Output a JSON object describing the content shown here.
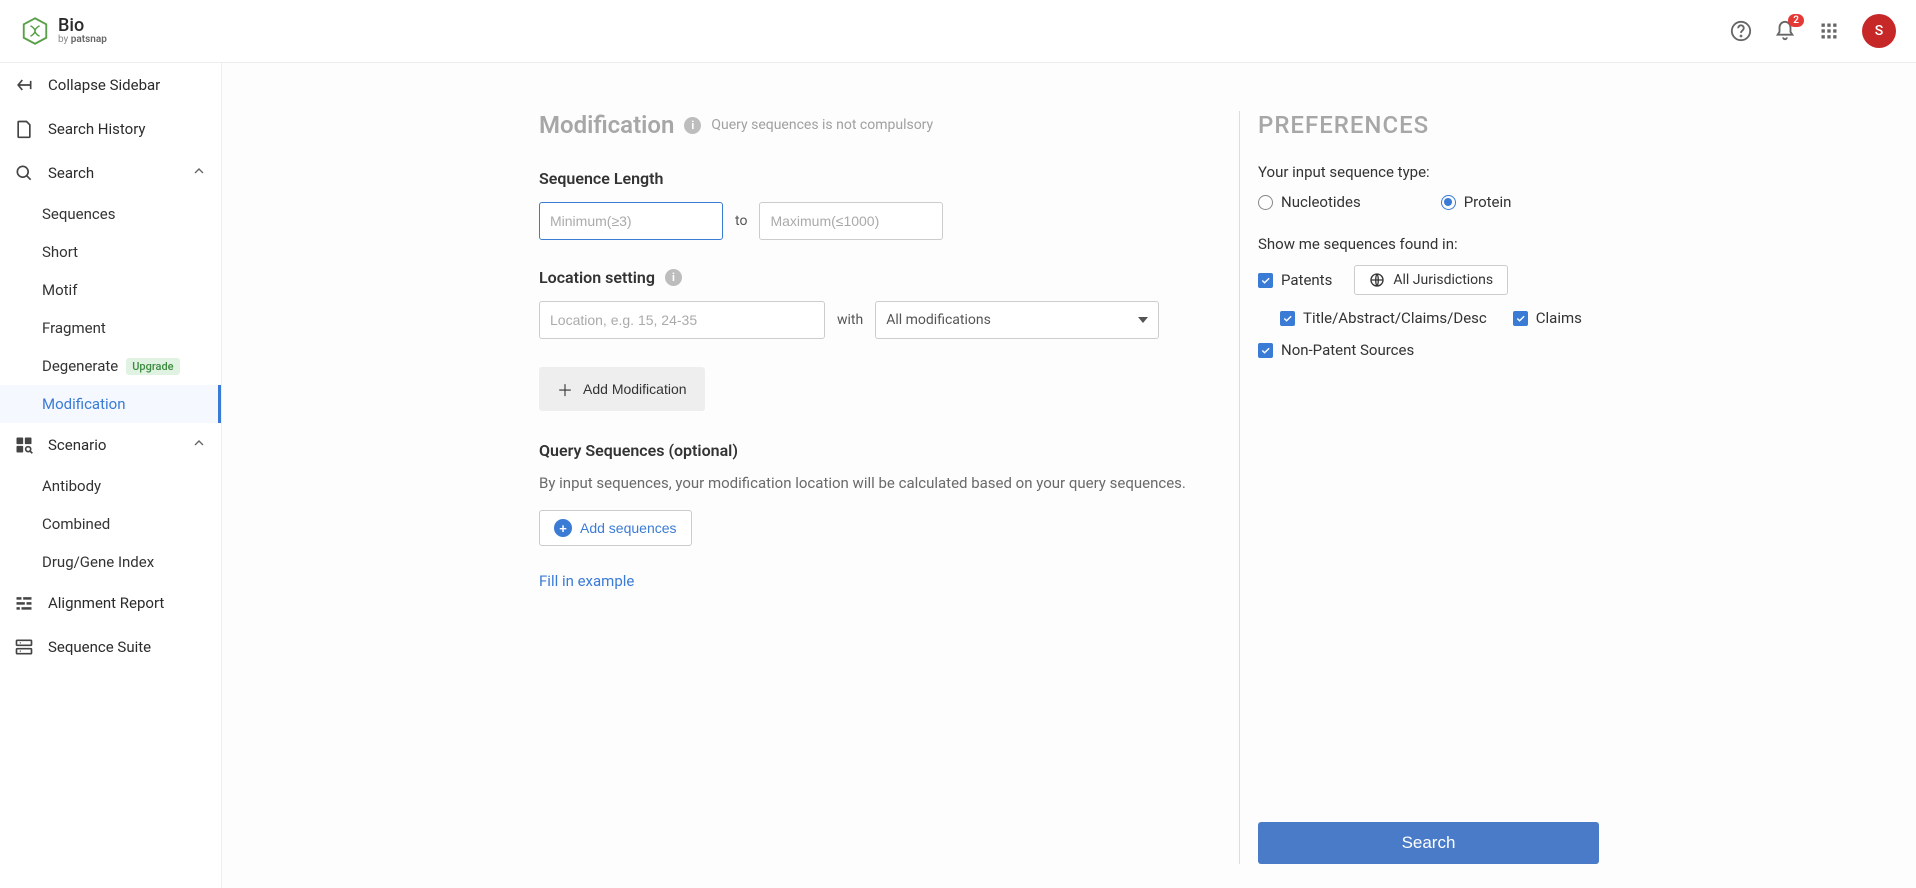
{
  "header": {
    "brand_title": "Bio",
    "brand_by_prefix": "by",
    "brand_by_name": "patsnap",
    "notification_count": "2",
    "avatar_initial": "S"
  },
  "sidebar": {
    "collapse": "Collapse Sidebar",
    "history": "Search History",
    "search": "Search",
    "search_items": {
      "sequences": "Sequences",
      "short": "Short",
      "motif": "Motif",
      "fragment": "Fragment",
      "degenerate": "Degenerate",
      "modification": "Modification"
    },
    "upgrade_tag": "Upgrade",
    "scenario": "Scenario",
    "scenario_items": {
      "antibody": "Antibody",
      "combined": "Combined",
      "drug_gene": "Drug/Gene Index"
    },
    "alignment": "Alignment Report",
    "suite": "Sequence Suite"
  },
  "main": {
    "title": "Modification",
    "title_note": "Query sequences is not compulsory",
    "seq_len_label": "Sequence Length",
    "min_placeholder": "Minimum(≥3)",
    "to": "to",
    "max_placeholder": "Maximum(≤1000)",
    "location_label": "Location setting",
    "location_placeholder": "Location, e.g. 15, 24-35",
    "with": "with",
    "modifications_selected": "All modifications",
    "add_modification": "Add Modification",
    "query_seq_label": "Query Sequences (optional)",
    "query_seq_desc": "By input sequences, your modification location will be calculated based on your query sequences.",
    "add_sequences": "Add sequences",
    "fill_example": "Fill in example"
  },
  "prefs": {
    "heading": "PREFERENCES",
    "input_type_label": "Your input sequence type:",
    "nucleotides": "Nucleotides",
    "protein": "Protein",
    "found_in_label": "Show me sequences found in:",
    "patents": "Patents",
    "all_jurisdictions": "All Jurisdictions",
    "tacd": "Title/Abstract/Claims/Desc",
    "claims": "Claims",
    "nonpatent": "Non-Patent Sources",
    "search": "Search"
  }
}
